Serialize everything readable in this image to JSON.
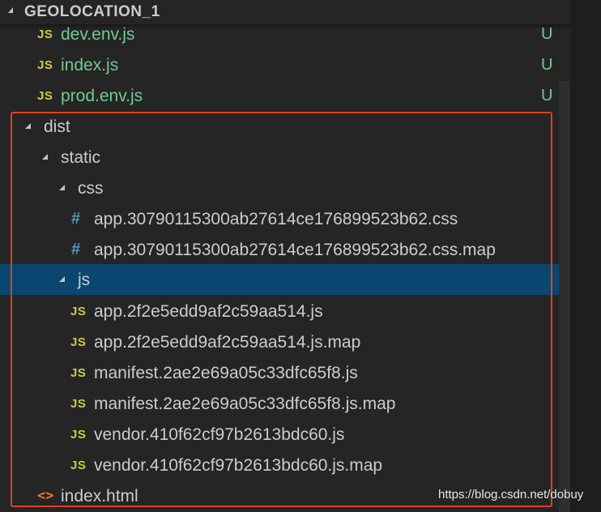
{
  "explorer": {
    "section_title": "GEOLOCATION_1",
    "rows": [
      {
        "label": "dev.env.js",
        "icon": "js-file-icon",
        "icon_text": "JS",
        "decoration": "U"
      },
      {
        "label": "index.js",
        "icon": "js-file-icon",
        "icon_text": "JS",
        "decoration": "U"
      },
      {
        "label": "prod.env.js",
        "icon": "js-file-icon",
        "icon_text": "JS",
        "decoration": "U"
      },
      {
        "label": "dist",
        "icon": "folder-expanded-twisty"
      },
      {
        "label": "static",
        "icon": "folder-expanded-twisty"
      },
      {
        "label": "css",
        "icon": "folder-expanded-twisty"
      },
      {
        "label": "app.30790115300ab27614ce176899523b62.css",
        "icon": "css-file-icon",
        "icon_text": "#"
      },
      {
        "label": "app.30790115300ab27614ce176899523b62.css.map",
        "icon": "css-file-icon",
        "icon_text": "#"
      },
      {
        "label": "js",
        "icon": "folder-expanded-twisty",
        "selected": true
      },
      {
        "label": "app.2f2e5edd9af2c59aa514.js",
        "icon": "js-file-icon",
        "icon_text": "JS"
      },
      {
        "label": "app.2f2e5edd9af2c59aa514.js.map",
        "icon": "js-file-icon",
        "icon_text": "JS"
      },
      {
        "label": "manifest.2ae2e69a05c33dfc65f8.js",
        "icon": "js-file-icon",
        "icon_text": "JS"
      },
      {
        "label": "manifest.2ae2e69a05c33dfc65f8.js.map",
        "icon": "js-file-icon",
        "icon_text": "JS"
      },
      {
        "label": "vendor.410f62cf97b2613bdc60.js",
        "icon": "js-file-icon",
        "icon_text": "JS"
      },
      {
        "label": "vendor.410f62cf97b2613bdc60.js.map",
        "icon": "js-file-icon",
        "icon_text": "JS"
      },
      {
        "label": "index.html",
        "icon": "html-file-icon",
        "icon_text": "<>"
      }
    ]
  },
  "watermark": "https://blog.csdn.net/dobuy",
  "colors": {
    "background": "#252526",
    "selection": "#094771",
    "untracked_text": "#73c991",
    "js_icon": "#cbcb41",
    "css_icon": "#519aba",
    "html_icon": "#e37933",
    "annotation_box": "#e0401f"
  }
}
